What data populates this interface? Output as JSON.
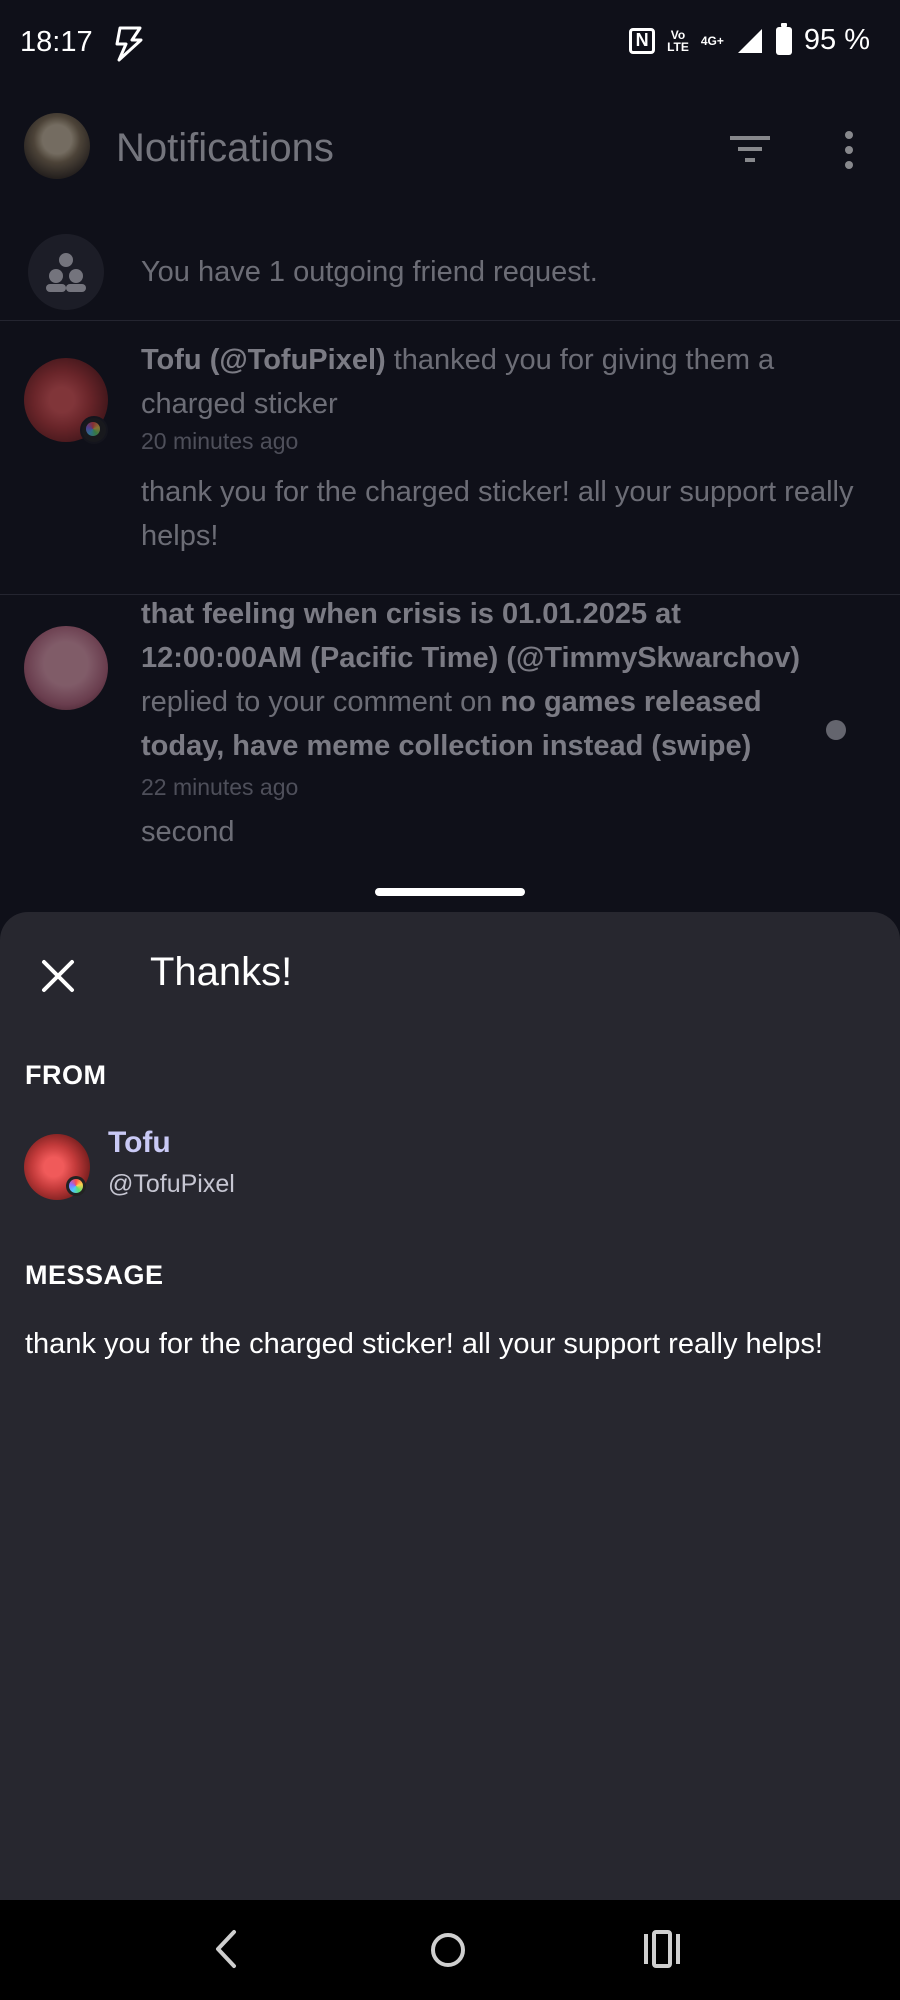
{
  "status_bar": {
    "time": "18:17",
    "nfc_label": "N",
    "volte_top": "Vo",
    "volte_bottom": "LTE",
    "network": "4G+",
    "battery_percent": "95 %"
  },
  "app_bar": {
    "title": "Notifications",
    "icons": [
      "filter-icon",
      "more-vertical-icon"
    ]
  },
  "friend_requests": {
    "text": "You have 1 outgoing friend request."
  },
  "notifications": [
    {
      "actor": "Tofu (@TofuPixel)",
      "action": " thanked you for giving them a charged sticker",
      "time": "20 minutes ago",
      "preview": "thank you for the charged sticker! all your support really helps!",
      "unread": false
    },
    {
      "actor": "that feeling when crisis is 01.01.2025 at 12:00:00AM (Pacific Time) (@TimmySkwarchov)",
      "action": " replied to your comment on ",
      "target": "no games released today, have meme collection instead (swipe)",
      "time": "22 minutes ago",
      "preview": "second",
      "unread": true
    }
  ],
  "sheet": {
    "title": "Thanks!",
    "from_label": "FROM",
    "from_name": "Tofu",
    "from_handle": "@TofuPixel",
    "message_label": "MESSAGE",
    "message": "thank you for the charged sticker! all your support really helps!"
  },
  "nav_bar": {
    "buttons": [
      "back-icon",
      "home-icon",
      "recents-icon"
    ]
  },
  "colors": {
    "background": "#0f1019",
    "sheet": "#27272f",
    "accent_name": "#c9c9f5"
  }
}
